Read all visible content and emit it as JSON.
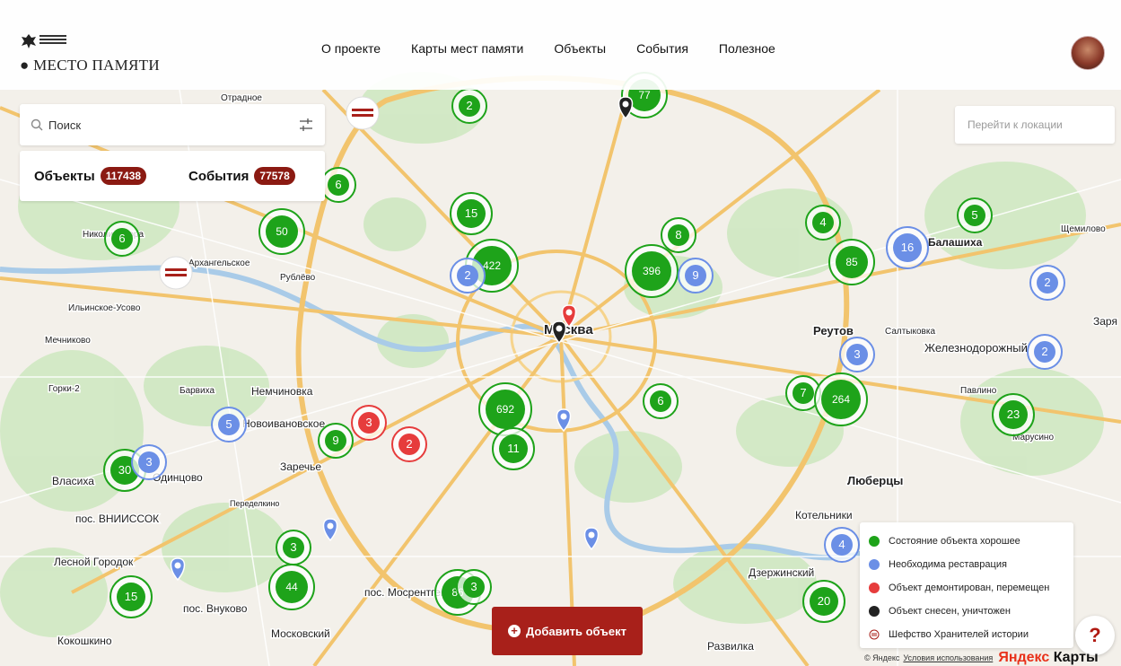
{
  "header": {
    "logo_text": "МЕСТО ПАМЯТИ",
    "nav": [
      "О проекте",
      "Карты мест памяти",
      "Объекты",
      "События",
      "Полезное"
    ]
  },
  "search": {
    "placeholder": "Поиск"
  },
  "counts": {
    "objects_label": "Объекты",
    "objects_value": "117438",
    "events_label": "События",
    "events_value": "77578"
  },
  "location": {
    "placeholder": "Перейти к локации"
  },
  "legend": [
    {
      "label": "Состояние объекта хорошее",
      "color": "#1ea31a"
    },
    {
      "label": "Необходима реставрация",
      "color": "#6b8fe6"
    },
    {
      "label": "Объект демонтирован, перемещен",
      "color": "#e63c3c"
    },
    {
      "label": "Объект снесен, уничтожен",
      "color": "#222222"
    },
    {
      "label": "Шефство Хранителей истории",
      "color": "#a8201a"
    }
  ],
  "add_button": "Добавить объект",
  "help": "?",
  "footer": {
    "copyright": "© Яндекс",
    "terms": "Условия использования",
    "brand_a": "Яндекс",
    "brand_b": "Карты"
  },
  "colors": {
    "green": "#1ea31a",
    "blue": "#6b8fe6",
    "red": "#e63c3c",
    "black": "#222222",
    "brand": "#a8201a"
  },
  "places": [
    {
      "name": "Москва"
    },
    {
      "name": "Реутов"
    },
    {
      "name": "Люберцы"
    },
    {
      "name": "Дзержинский"
    },
    {
      "name": "Одинцово"
    },
    {
      "name": "Немчиновка"
    },
    {
      "name": "Заречье"
    },
    {
      "name": "Новоивановское"
    },
    {
      "name": "Власиха"
    },
    {
      "name": "Лесной Городок"
    },
    {
      "name": "пос. Внуково"
    },
    {
      "name": "Кокошкино"
    },
    {
      "name": "пос. ВНИИССОК"
    },
    {
      "name": "Московский"
    },
    {
      "name": "пос. Мосрентген"
    },
    {
      "name": "Котельники"
    },
    {
      "name": "Железнодорожный"
    },
    {
      "name": "Салтыковка"
    },
    {
      "name": "Заря"
    },
    {
      "name": "Щемилово"
    },
    {
      "name": "Павлино"
    },
    {
      "name": "Марусино"
    },
    {
      "name": "Архангельское"
    },
    {
      "name": "Рублёво"
    },
    {
      "name": "Ильинское-Усово"
    },
    {
      "name": "Мечниково"
    },
    {
      "name": "Горки-2"
    },
    {
      "name": "Барвиха"
    },
    {
      "name": "Николина гора"
    },
    {
      "name": "Отрадное"
    },
    {
      "name": "Развилка"
    },
    {
      "name": "Переделкино"
    },
    {
      "name": "Балашиха"
    }
  ],
  "clusters": [
    {
      "n": "2",
      "c": "green"
    },
    {
      "n": "77",
      "c": "green"
    },
    {
      "n": "6",
      "c": "green"
    },
    {
      "n": "15",
      "c": "green"
    },
    {
      "n": "50",
      "c": "green"
    },
    {
      "n": "6",
      "c": "green"
    },
    {
      "n": "422",
      "c": "green"
    },
    {
      "n": "396",
      "c": "green"
    },
    {
      "n": "9",
      "c": "blue"
    },
    {
      "n": "8",
      "c": "green"
    },
    {
      "n": "4",
      "c": "green"
    },
    {
      "n": "5",
      "c": "green"
    },
    {
      "n": "16",
      "c": "blue"
    },
    {
      "n": "85",
      "c": "green"
    },
    {
      "n": "2",
      "c": "blue"
    },
    {
      "n": "3",
      "c": "blue"
    },
    {
      "n": "2",
      "c": "blue"
    },
    {
      "n": "7",
      "c": "green"
    },
    {
      "n": "264",
      "c": "green"
    },
    {
      "n": "23",
      "c": "green"
    },
    {
      "n": "692",
      "c": "green"
    },
    {
      "n": "11",
      "c": "green"
    },
    {
      "n": "6",
      "c": "green"
    },
    {
      "n": "5",
      "c": "blue"
    },
    {
      "n": "3",
      "c": "red"
    },
    {
      "n": "2",
      "c": "red"
    },
    {
      "n": "9",
      "c": "green"
    },
    {
      "n": "30",
      "c": "green"
    },
    {
      "n": "3",
      "c": "blue"
    },
    {
      "n": "3",
      "c": "green"
    },
    {
      "n": "44",
      "c": "green"
    },
    {
      "n": "15",
      "c": "green"
    },
    {
      "n": "86",
      "c": "green"
    },
    {
      "n": "3",
      "c": "green"
    },
    {
      "n": "4",
      "c": "blue"
    },
    {
      "n": "20",
      "c": "green"
    },
    {
      "n": "2",
      "c": "blue"
    }
  ]
}
